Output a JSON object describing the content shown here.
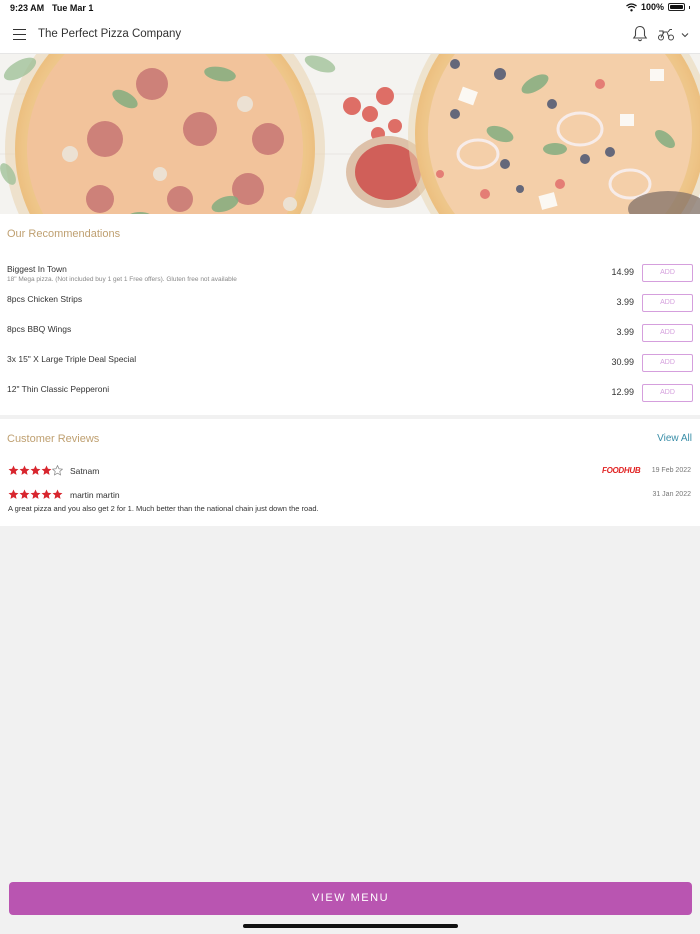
{
  "status_bar": {
    "time": "9:23 AM",
    "date": "Tue Mar 1",
    "battery": "100%"
  },
  "header": {
    "title": "The Perfect Pizza Company",
    "icons": [
      "menu-icon",
      "bell-icon",
      "scooter-icon",
      "chevron-down-icon"
    ]
  },
  "recommendations": {
    "title": "Our Recommendations",
    "add_label": "ADD",
    "items": [
      {
        "name": "Biggest In Town",
        "description": "18\" Mega pizza. (Not included buy 1 get 1 Free offers). Gluten free not available",
        "price": "14.99"
      },
      {
        "name": "8pcs Chicken Strips",
        "description": "",
        "price": "3.99"
      },
      {
        "name": "8pcs BBQ Wings",
        "description": "",
        "price": "3.99"
      },
      {
        "name": "3x 15\" X Large Triple Deal Special",
        "description": "",
        "price": "30.99"
      },
      {
        "name": "12\" Thin Classic Pepperoni",
        "description": "",
        "price": "12.99"
      }
    ]
  },
  "reviews": {
    "title": "Customer Reviews",
    "view_all": "View All",
    "items": [
      {
        "reviewer": "Satnam",
        "rating": 4,
        "source": "FOODHUB",
        "date": "19 Feb 2022",
        "text": ""
      },
      {
        "reviewer": "martin martin",
        "rating": 5,
        "source": "",
        "date": "31 Jan 2022",
        "text": "A great pizza and you also get 2 for 1. Much better than the national chain just down the road."
      }
    ]
  },
  "footer": {
    "button_label": "VIEW MENU"
  },
  "colors": {
    "accent": "#b955b1",
    "section_title": "#bfa071",
    "link": "#3a8ea8",
    "star": "#d8262e",
    "add_border": "#d59fdd"
  }
}
